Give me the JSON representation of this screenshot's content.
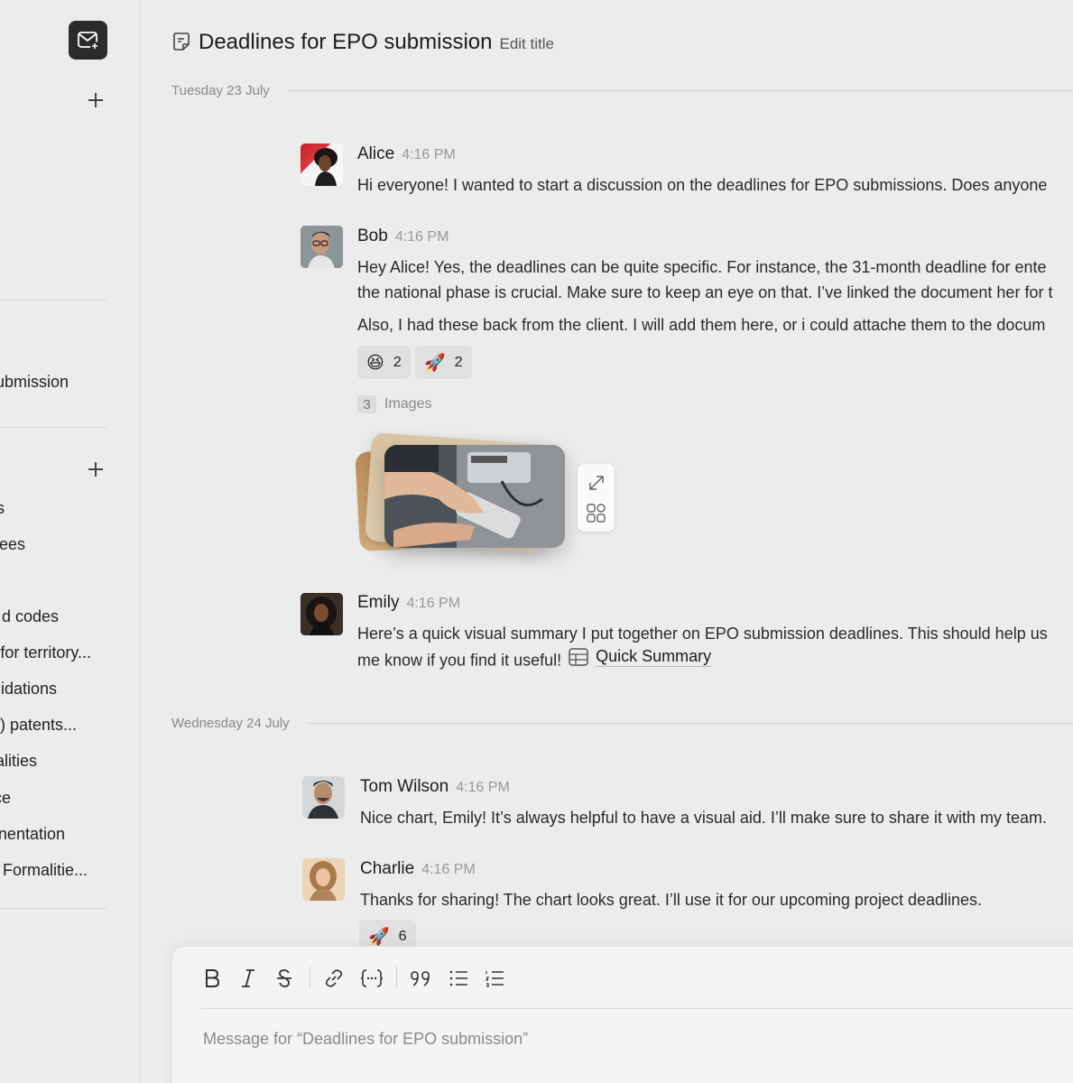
{
  "sidebar": {
    "items": [
      {
        "label": "ubmission"
      },
      {
        "label": "s"
      },
      {
        "label": "ees"
      },
      {
        "label": "d codes"
      },
      {
        "label": "for territory..."
      },
      {
        "label": "idations"
      },
      {
        "label": ") patents..."
      },
      {
        "label": "alities"
      },
      {
        "label": "ce"
      },
      {
        "label": "nentation"
      },
      {
        "label": " Formalitie..."
      }
    ]
  },
  "header": {
    "title": "Deadlines for EPO submission",
    "edit_label": "Edit title"
  },
  "dates": {
    "first": "Tuesday 23 July",
    "second": "Wednesday 24 July"
  },
  "messages": {
    "alice": {
      "name": "Alice",
      "time": "4:16 PM",
      "text": "Hi everyone! I wanted to start a discussion on the deadlines for EPO submissions. Does anyone"
    },
    "bob": {
      "name": "Bob",
      "time": "4:16 PM",
      "line1": "Hey Alice! Yes, the deadlines can be quite specific. For instance, the 31-month deadline for  ente",
      "line2": "the national phase is crucial. Make sure to keep an eye on that. I’ve linked the document her for t",
      "line3": "Also, I had these back from the client. I will add them here, or i could attache them to the docum",
      "reactions": [
        {
          "emoji": "😆",
          "count": "2"
        },
        {
          "emoji": "🚀",
          "count": "2"
        }
      ],
      "images_count": "3",
      "images_label": "Images"
    },
    "emily": {
      "name": "Emily",
      "time": "4:16 PM",
      "line1": "Here’s a quick visual summary I put together on EPO submission deadlines. This should help us",
      "line2": "me know if you find it useful!",
      "link_label": "Quick Summary"
    },
    "tom": {
      "name": "Tom Wilson",
      "time": "4:16 PM",
      "text": "Nice chart, Emily! It’s always helpful to have a visual aid. I’ll make sure to share it with my team."
    },
    "charlie": {
      "name": "Charlie",
      "time": "4:16 PM",
      "text": "Thanks for sharing! The chart looks great. I’ll use it for our upcoming project deadlines.",
      "reactions": [
        {
          "emoji": "🚀",
          "count": "6"
        }
      ]
    }
  },
  "composer": {
    "placeholder": "Message for “Deadlines for EPO submission”"
  }
}
